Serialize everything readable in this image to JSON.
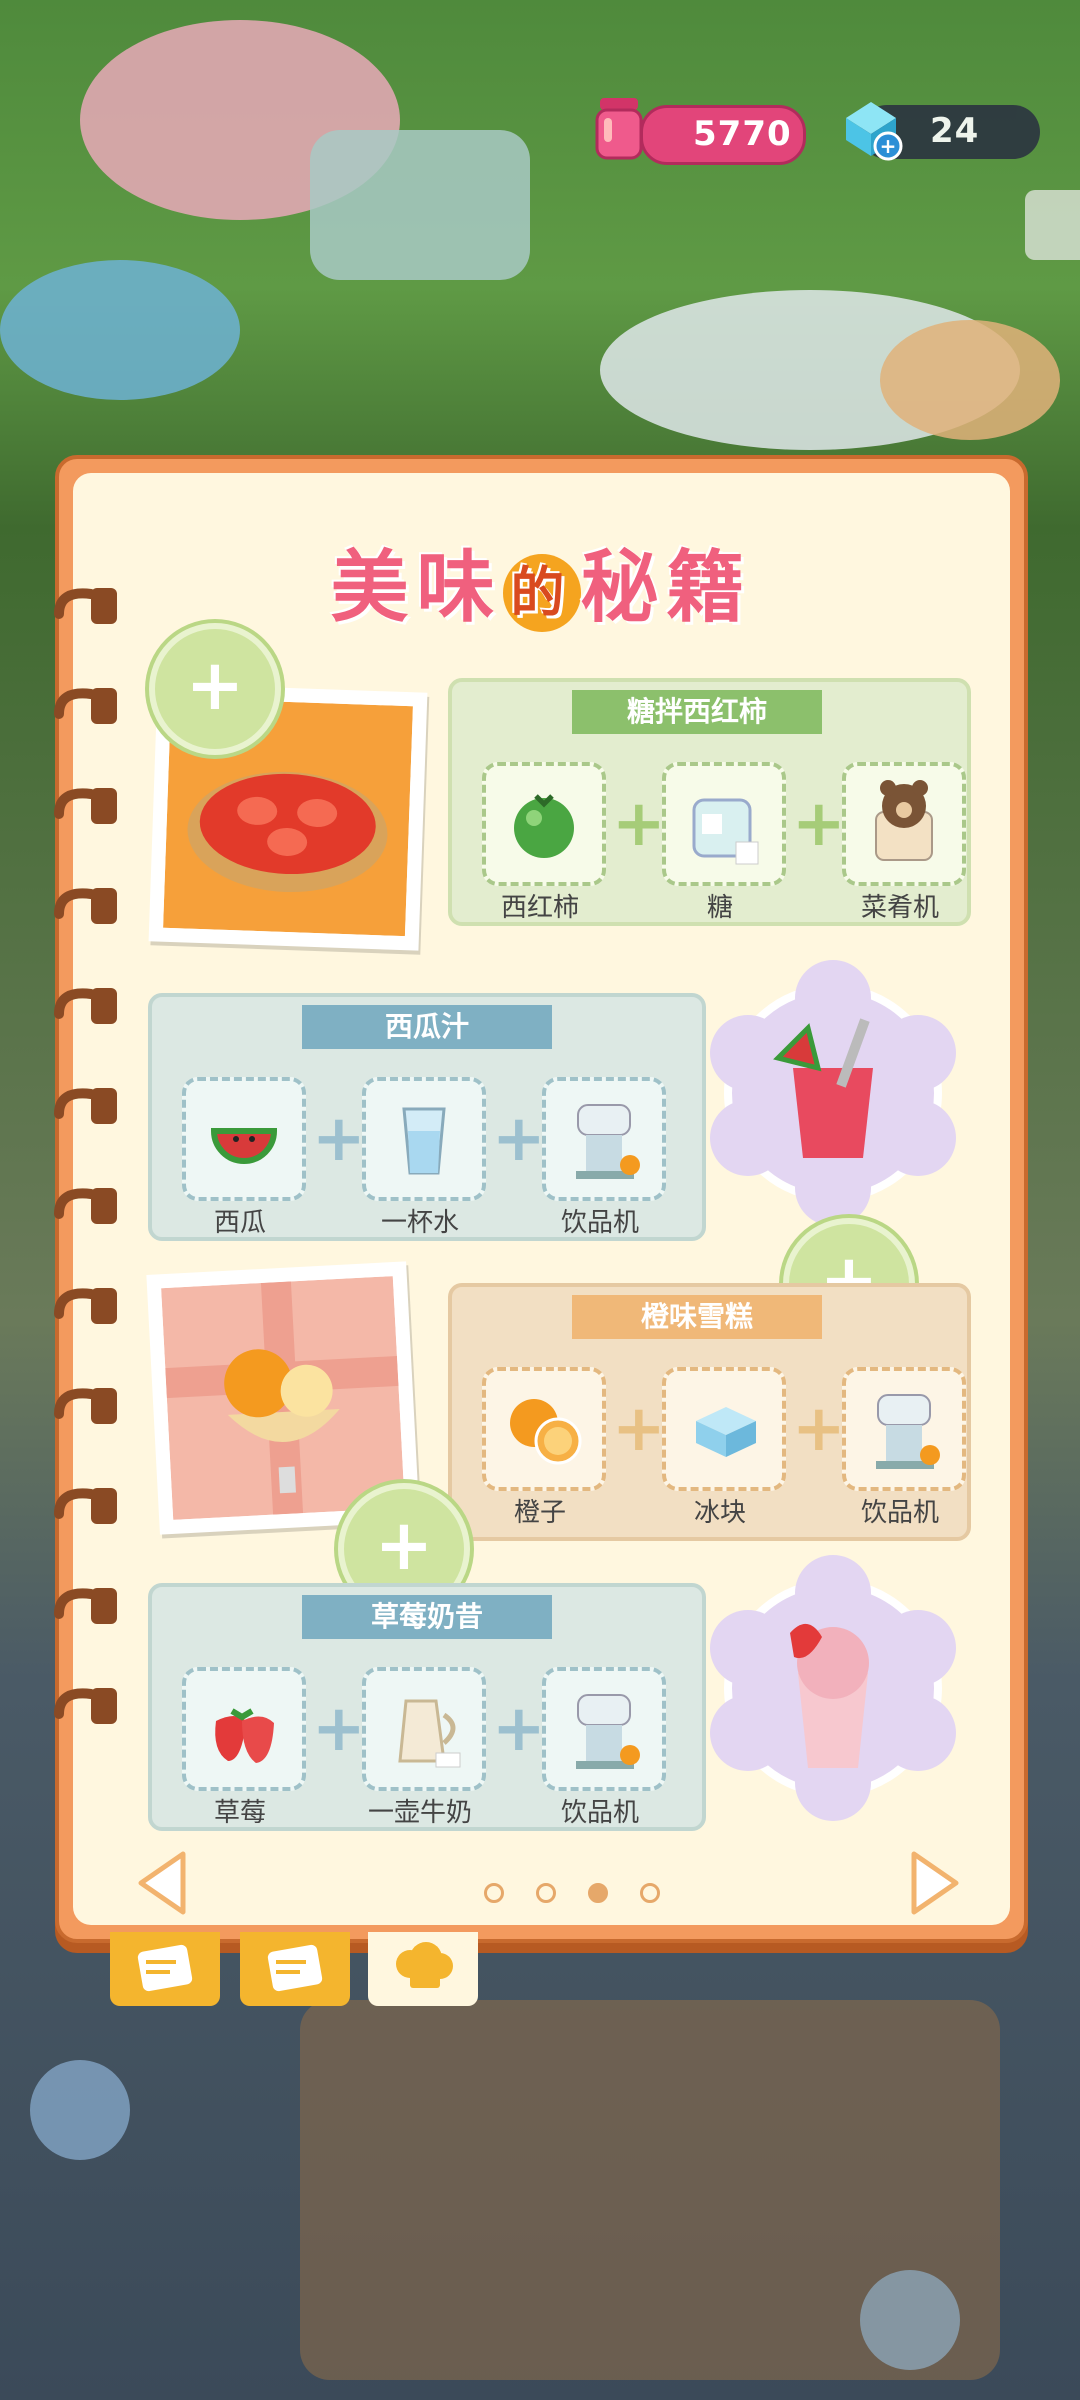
{
  "hud": {
    "jam_count": "5770",
    "gem_count": "24"
  },
  "book": {
    "title_part1": "美味",
    "title_dot": "的",
    "title_part2": "秘籍"
  },
  "recipes": [
    {
      "name": "糖拌西红柿",
      "ingredients": [
        "西红柿",
        "糖",
        "菜肴机"
      ]
    },
    {
      "name": "西瓜汁",
      "ingredients": [
        "西瓜",
        "一杯水",
        "饮品机"
      ]
    },
    {
      "name": "橙味雪糕",
      "ingredients": [
        "橙子",
        "冰块",
        "饮品机"
      ]
    },
    {
      "name": "草莓奶昔",
      "ingredients": [
        "草莓",
        "一壶牛奶",
        "饮品机"
      ]
    }
  ],
  "pagination": {
    "current_page": 3,
    "total_pages": 4
  },
  "colors": {
    "book_orange": "#f39a5e",
    "paper": "#fff7df",
    "title_pink": "#f0607e",
    "tab_yellow": "#f4b52e"
  }
}
